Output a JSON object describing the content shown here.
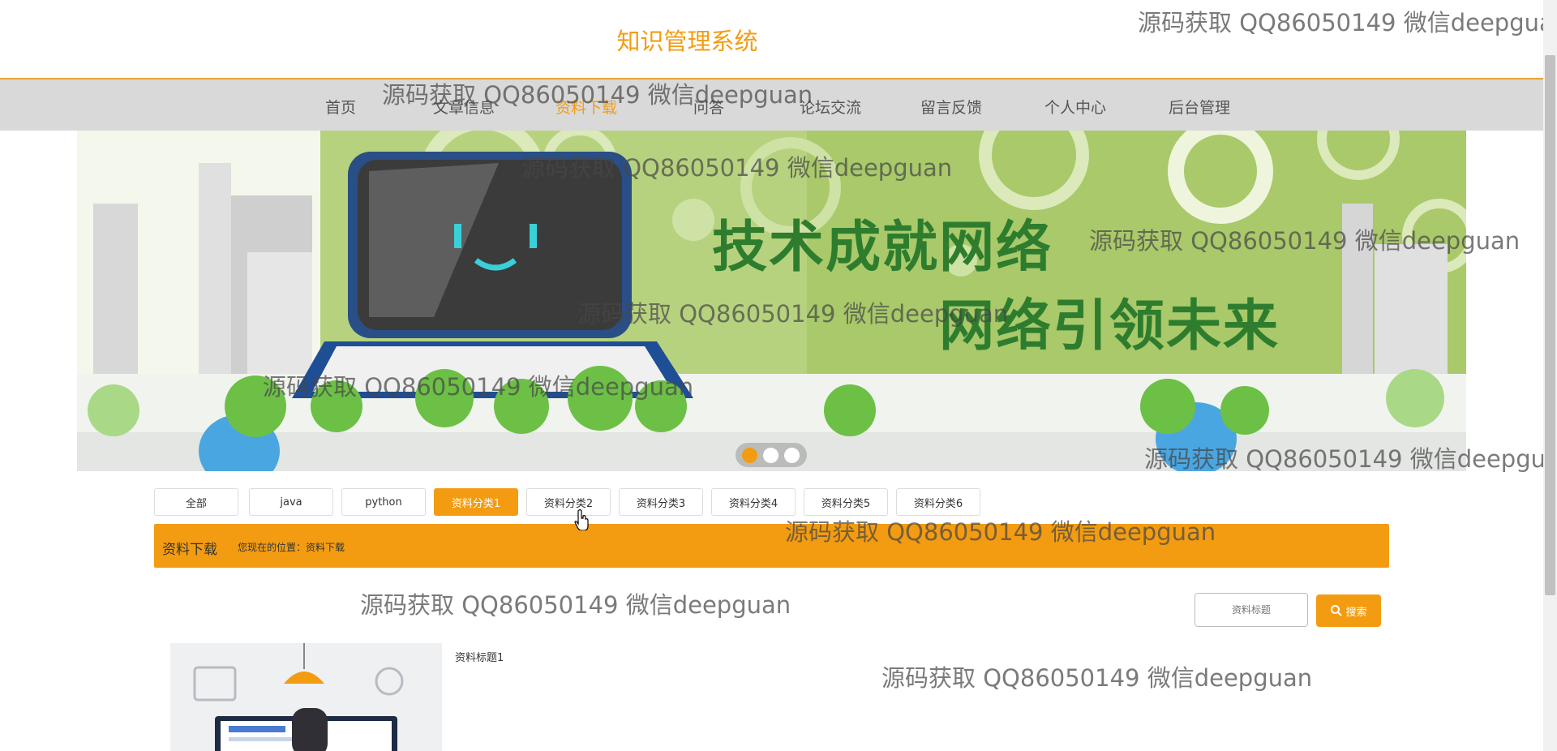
{
  "site": {
    "title": "知识管理系统"
  },
  "nav": {
    "items": [
      {
        "label": "首页"
      },
      {
        "label": "文章信息"
      },
      {
        "label": "资料下载"
      },
      {
        "label": "问答"
      },
      {
        "label": "论坛交流"
      },
      {
        "label": "留言反馈"
      },
      {
        "label": "个人中心"
      },
      {
        "label": "后台管理"
      }
    ],
    "active_index": 2
  },
  "banner": {
    "headline1": "技术成就网络",
    "headline2": "网络引领未来",
    "slide_count": 3,
    "active_slide": 0
  },
  "categories": {
    "items": [
      {
        "label": "全部"
      },
      {
        "label": "java"
      },
      {
        "label": "python"
      },
      {
        "label": "资料分类1"
      },
      {
        "label": "资料分类2"
      },
      {
        "label": "资料分类3"
      },
      {
        "label": "资料分类4"
      },
      {
        "label": "资料分类5"
      },
      {
        "label": "资料分类6"
      }
    ],
    "active_index": 3
  },
  "breadcrumb": {
    "title": "资料下载",
    "location": "您现在的位置：资料下载"
  },
  "search": {
    "placeholder": "资料标题",
    "button_label": "搜索"
  },
  "list": {
    "items": [
      {
        "title": "资料标题1"
      }
    ]
  },
  "watermark": {
    "text": "源码获取 QQ86050149 微信deepguan"
  },
  "colors": {
    "accent": "#f39c12",
    "nav_bg": "#d9d9d9",
    "banner_green": "#8dba4a",
    "headline_green": "#2e7d2e"
  }
}
